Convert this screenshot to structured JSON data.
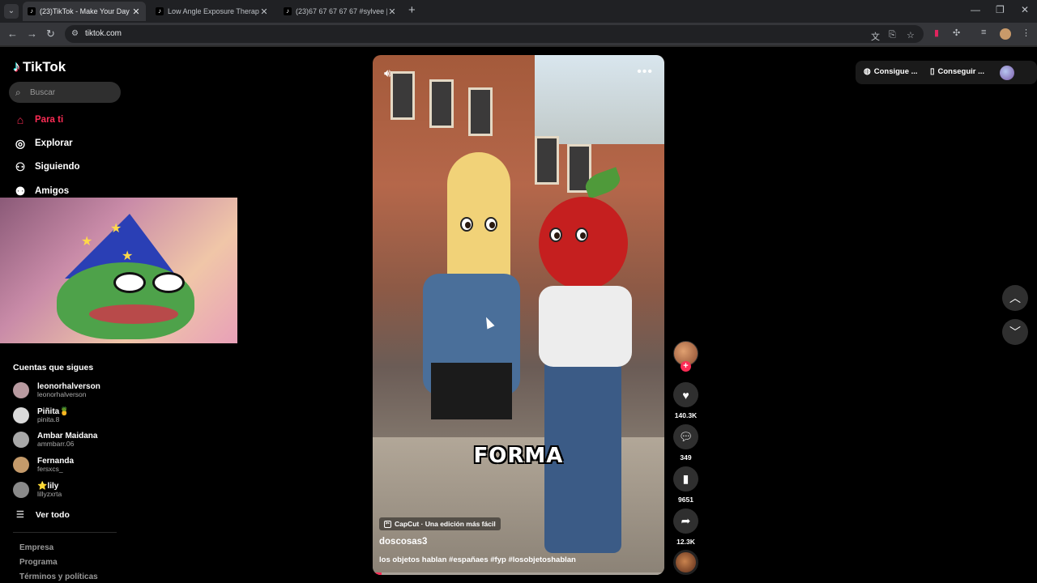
{
  "browser": {
    "tabs": [
      {
        "title": "(23)TikTok - Make Your Day",
        "active": true
      },
      {
        "title": "Low Angle Exposure Therapy fo",
        "active": false
      },
      {
        "title": "(23)67 67 67 67 67 #sylvee | Tik",
        "active": false
      }
    ],
    "url": "tiktok.com"
  },
  "tiktok": {
    "logo_text": "TikTok",
    "search_placeholder": "Buscar",
    "nav": [
      {
        "label": "Para ti",
        "icon": "home-icon",
        "active": true
      },
      {
        "label": "Explorar",
        "icon": "compass-icon",
        "active": false
      },
      {
        "label": "Siguiendo",
        "icon": "following-icon",
        "active": false
      },
      {
        "label": "Amigos",
        "icon": "friends-icon",
        "active": false
      }
    ],
    "following_title": "Cuentas que sigues",
    "following": [
      {
        "name": "leonorhalverson",
        "handle": "leonorhalverson",
        "color": "#b89aa0"
      },
      {
        "name": "Piñita🍍",
        "handle": "pinita.8",
        "color": "#d9d9d9"
      },
      {
        "name": "Ambar Maidana",
        "handle": "ammbarr.06",
        "color": "#a8a8a8"
      },
      {
        "name": "Fernanda",
        "handle": "fersxcs_",
        "color": "#c49a6a"
      },
      {
        "name": "⭐lily",
        "handle": "lillyzxrta",
        "color": "#8a8a8a"
      }
    ],
    "see_all": "Ver todo",
    "footer_links": [
      "Empresa",
      "Programa",
      "Términos y políticas"
    ],
    "top_buttons": [
      "Consigue ...",
      "Conseguir ..."
    ]
  },
  "video": {
    "caption_overlay": "FORMA",
    "capcut_label": "CapCut · Una edición más fácil",
    "author": "doscosas3",
    "description": "los objetos hablan #españaes #fyp #losobjetoshablan",
    "progress": 0.03
  },
  "actions": {
    "likes": "140.3K",
    "comments": "349",
    "saves": "9651",
    "shares": "12.3K"
  }
}
